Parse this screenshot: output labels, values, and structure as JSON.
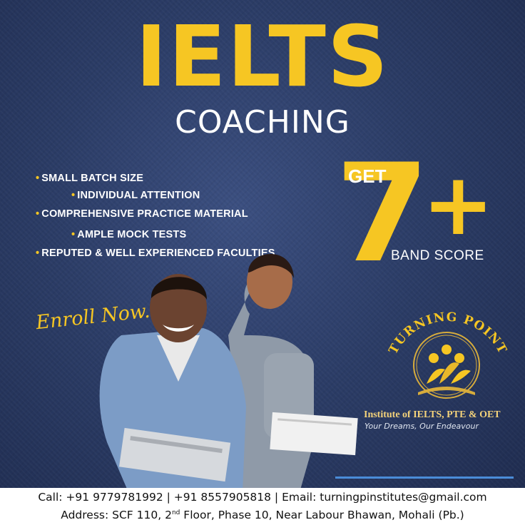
{
  "header": {
    "title": "IELTS",
    "subtitle": "COACHING"
  },
  "features": [
    "SMALL BATCH SIZE",
    "INDIVIDUAL ATTENTION",
    "COMPREHENSIVE PRACTICE MATERIAL",
    "AMPLE MOCK TESTS",
    "REPUTED & WELL EXPERIENCED FACULTIES"
  ],
  "score_promo": {
    "get": "GET",
    "number": "7",
    "plus": "+",
    "label": "BAND SCORE"
  },
  "cta": {
    "enroll": "Enroll Now..."
  },
  "brand": {
    "name": "TURNING POINT",
    "institute": "Institute of IELTS, PTE & OET",
    "tagline": "Your Dreams, Our Endeavour"
  },
  "contact": {
    "line1": "Call: +91 9779781992 | +91 8557905818 | Email: turningpinstitutes@gmail.com",
    "address_prefix": "Address: SCF 110, 2",
    "address_sup": "nd",
    "address_suffix": " Floor, Phase 10, Near Labour Bhawan, Mohali (Pb.)"
  },
  "colors": {
    "accent": "#f6c623",
    "background": "#2b3c66",
    "footer_bg": "#ffffff"
  },
  "icons": [
    "bullet-dot-icon",
    "turning-point-logo-icon"
  ]
}
